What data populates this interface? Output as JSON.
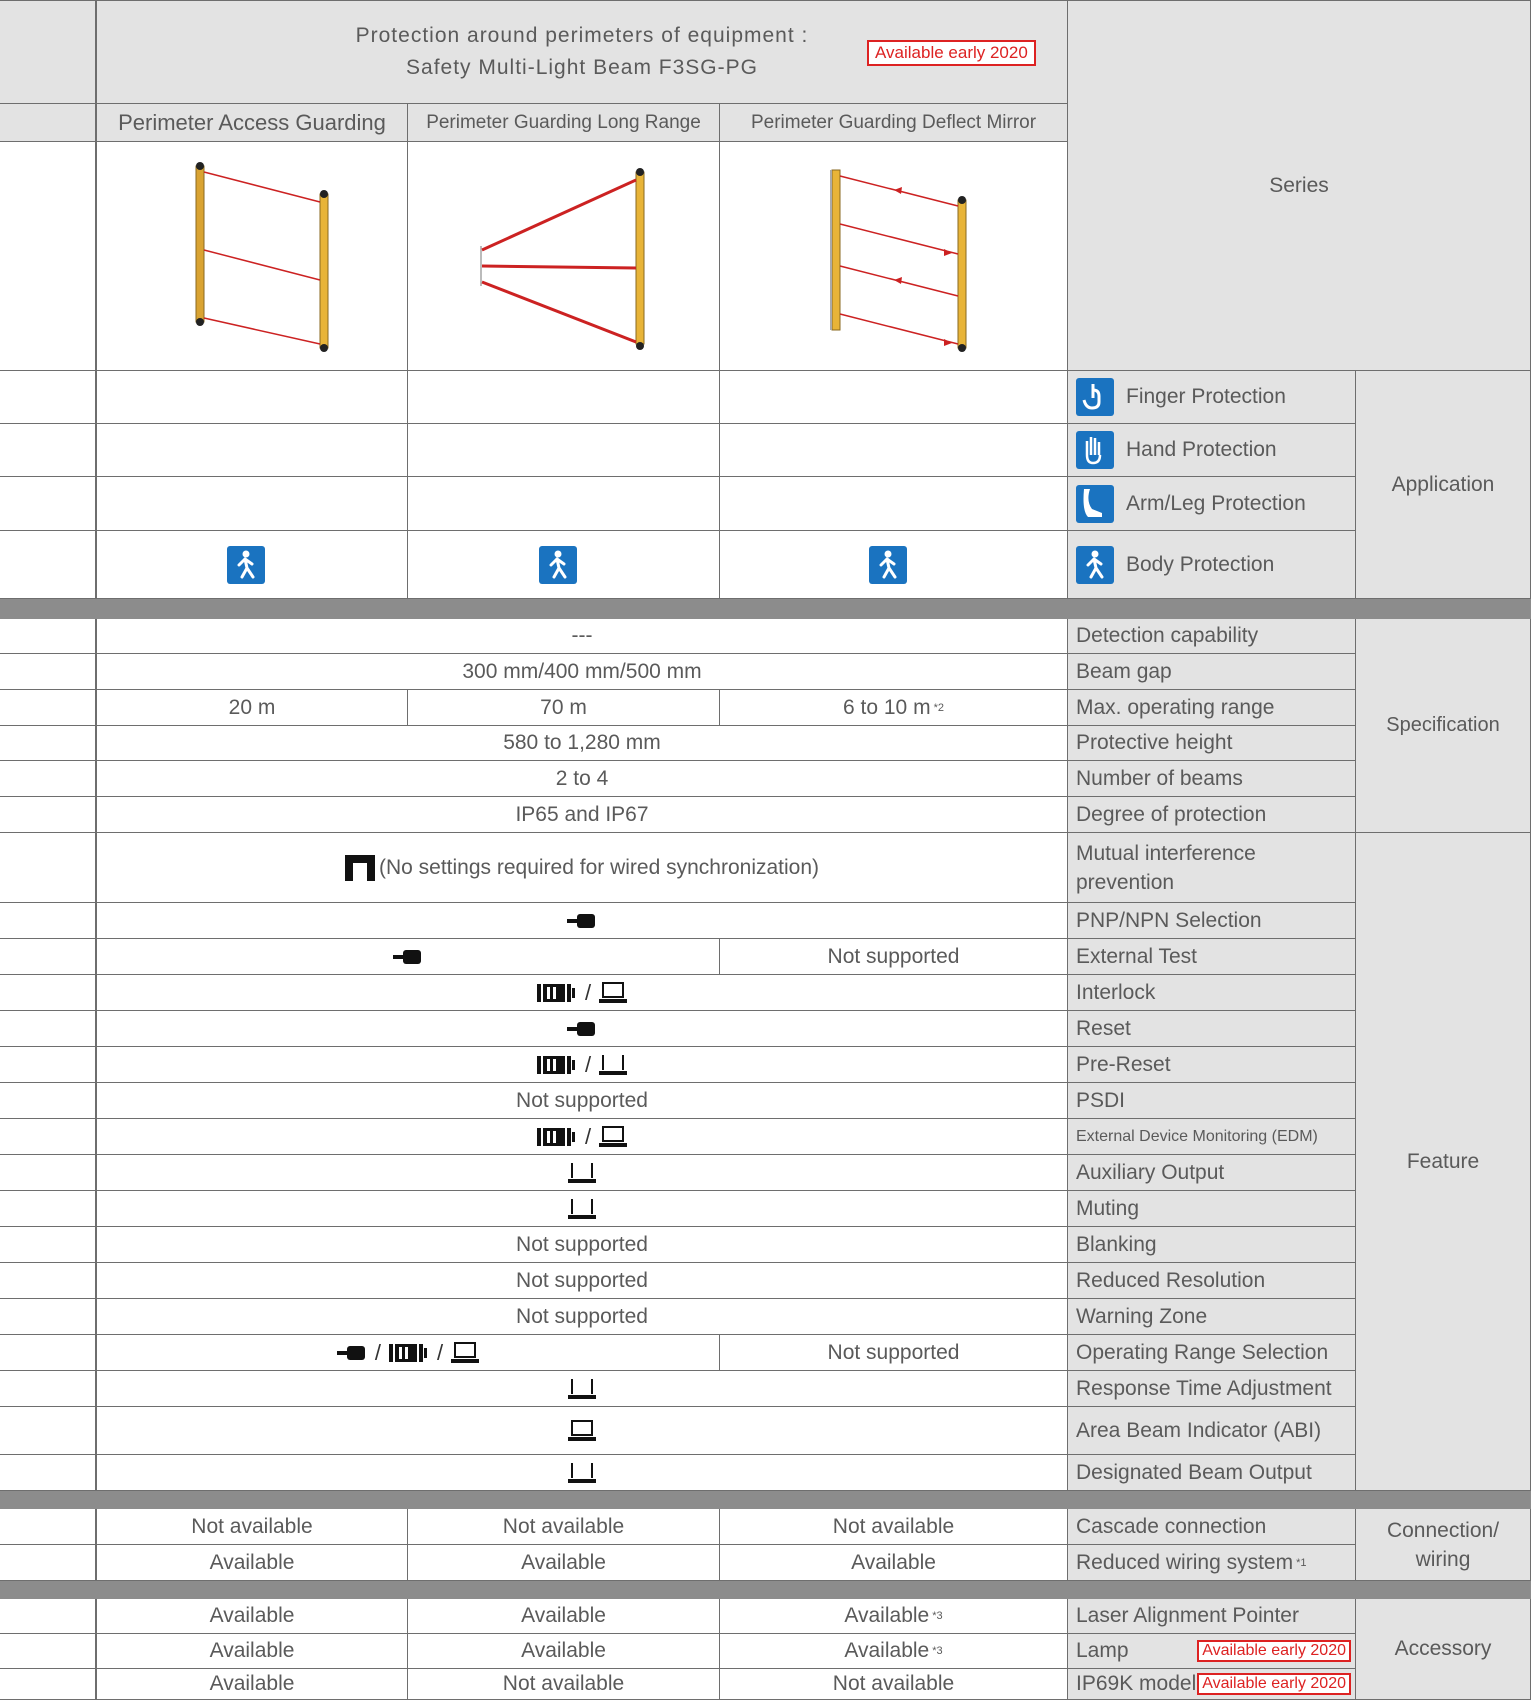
{
  "header": {
    "title_line1": "Protection around perimeters of equipment :",
    "title_line2": "Safety Multi-Light Beam F3SG-PG",
    "badge": "Available early 2020",
    "series_label": "Series",
    "columns": [
      "Perimeter Access Guarding",
      "Perimeter Guarding Long Range",
      "Perimeter Guarding Deflect Mirror"
    ]
  },
  "application": {
    "group_label": "Application",
    "rows": [
      {
        "label": "Finger Protection",
        "icon": "finger-icon"
      },
      {
        "label": "Hand Protection",
        "icon": "hand-icon"
      },
      {
        "label": "Arm/Leg Protection",
        "icon": "leg-icon"
      },
      {
        "label": "Body Protection",
        "icon": "body-icon"
      }
    ]
  },
  "specification": {
    "group_label": "Specification",
    "rows": [
      {
        "label": "Detection capability",
        "value": "---"
      },
      {
        "label": "Beam gap",
        "value": "300 mm/400 mm/500 mm"
      },
      {
        "label": "Max. operating range",
        "values": [
          "20 m",
          "70 m",
          "6 to 10 m"
        ],
        "note": "*2"
      },
      {
        "label": "Protective height",
        "value": "580 to 1,280 mm"
      },
      {
        "label": "Number of beams",
        "value": "2 to 4"
      },
      {
        "label": "Degree of protection",
        "value": "IP65 and IP67"
      }
    ]
  },
  "feature": {
    "group_label": "Feature",
    "mutual": {
      "label_line1": "Mutual interference",
      "label_line2": "prevention",
      "value": "(No settings required for wired synchronization)"
    },
    "rows": [
      {
        "label": "PNP/NPN Selection"
      },
      {
        "label": "External Test",
        "right": "Not supported"
      },
      {
        "label": "Interlock"
      },
      {
        "label": "Reset"
      },
      {
        "label": "Pre-Reset"
      },
      {
        "label": "PSDI",
        "value": "Not supported"
      },
      {
        "label": "External Device Monitoring (EDM)"
      },
      {
        "label": "Auxiliary Output"
      },
      {
        "label": "Muting"
      },
      {
        "label": "Blanking",
        "value": "Not supported"
      },
      {
        "label": "Reduced Resolution",
        "value": "Not supported"
      },
      {
        "label": "Warning Zone",
        "value": "Not supported"
      },
      {
        "label": "Operating Range Selection",
        "right": "Not supported"
      },
      {
        "label": "Response Time Adjustment"
      },
      {
        "label": "Area Beam Indicator (ABI)"
      },
      {
        "label": "Designated Beam Output"
      }
    ]
  },
  "connection": {
    "group_label_line1": "Connection/",
    "group_label_line2": "wiring",
    "rows": [
      {
        "label": "Cascade connection",
        "values": [
          "Not available",
          "Not available",
          "Not available"
        ]
      },
      {
        "label": "Reduced wiring system",
        "note": "*1",
        "values": [
          "Available",
          "Available",
          "Available"
        ]
      }
    ]
  },
  "accessory": {
    "group_label": "Accessory",
    "rows": [
      {
        "label": "Laser Alignment Pointer",
        "values": [
          "Available",
          "Available",
          "Available"
        ],
        "note3": "*3"
      },
      {
        "label": "Lamp",
        "values": [
          "Available",
          "Available",
          "Available"
        ],
        "note3": "*3",
        "badge": "Available early 2020"
      },
      {
        "label": "IP69K model",
        "values": [
          "Available",
          "Not available",
          "Not available"
        ],
        "badge": "Available early 2020"
      }
    ]
  },
  "colors": {
    "badge_red": "#d22222",
    "icon_blue": "#1a73c0",
    "band_gray": "#8c8c8c",
    "header_gray": "#e3e3e3"
  }
}
